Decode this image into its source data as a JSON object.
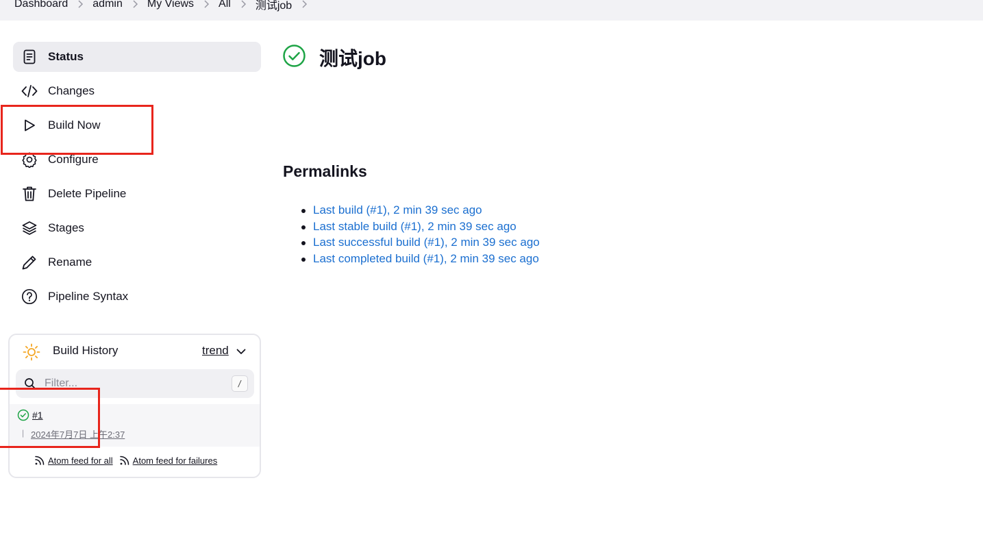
{
  "breadcrumbs": [
    "Dashboard",
    "admin",
    "My Views",
    "All",
    "测试job"
  ],
  "tasks": [
    {
      "label": "Status",
      "icon": "document-icon",
      "active": true
    },
    {
      "label": "Changes",
      "icon": "code-icon"
    },
    {
      "label": "Build Now",
      "icon": "play-icon"
    },
    {
      "label": "Configure",
      "icon": "gear-icon"
    },
    {
      "label": "Delete Pipeline",
      "icon": "trash-icon"
    },
    {
      "label": "Stages",
      "icon": "layers-icon"
    },
    {
      "label": "Rename",
      "icon": "pencil-icon"
    },
    {
      "label": "Pipeline Syntax",
      "icon": "help-circle-icon"
    }
  ],
  "build_history": {
    "title": "Build History",
    "trend_label": "trend",
    "filter_placeholder": "Filter...",
    "filter_shortcut": "/",
    "builds": [
      {
        "number": "#1",
        "separator": "|",
        "timestamp": "2024年7月7日 上午2:37",
        "status": "success"
      }
    ],
    "feeds": [
      "Atom feed for all",
      "Atom feed for failures"
    ]
  },
  "job": {
    "title": "测试job",
    "status": "success"
  },
  "permalinks": {
    "title": "Permalinks",
    "items": [
      "Last build (#1), 2 min 39 sec ago",
      "Last stable build (#1), 2 min 39 sec ago",
      "Last successful build (#1), 2 min 39 sec ago",
      "Last completed build (#1), 2 min 39 sec ago"
    ]
  },
  "colors": {
    "success": "#1ea446",
    "link": "#1b6fd0",
    "annotation": "#e8251c",
    "sun": "#f5a623"
  }
}
